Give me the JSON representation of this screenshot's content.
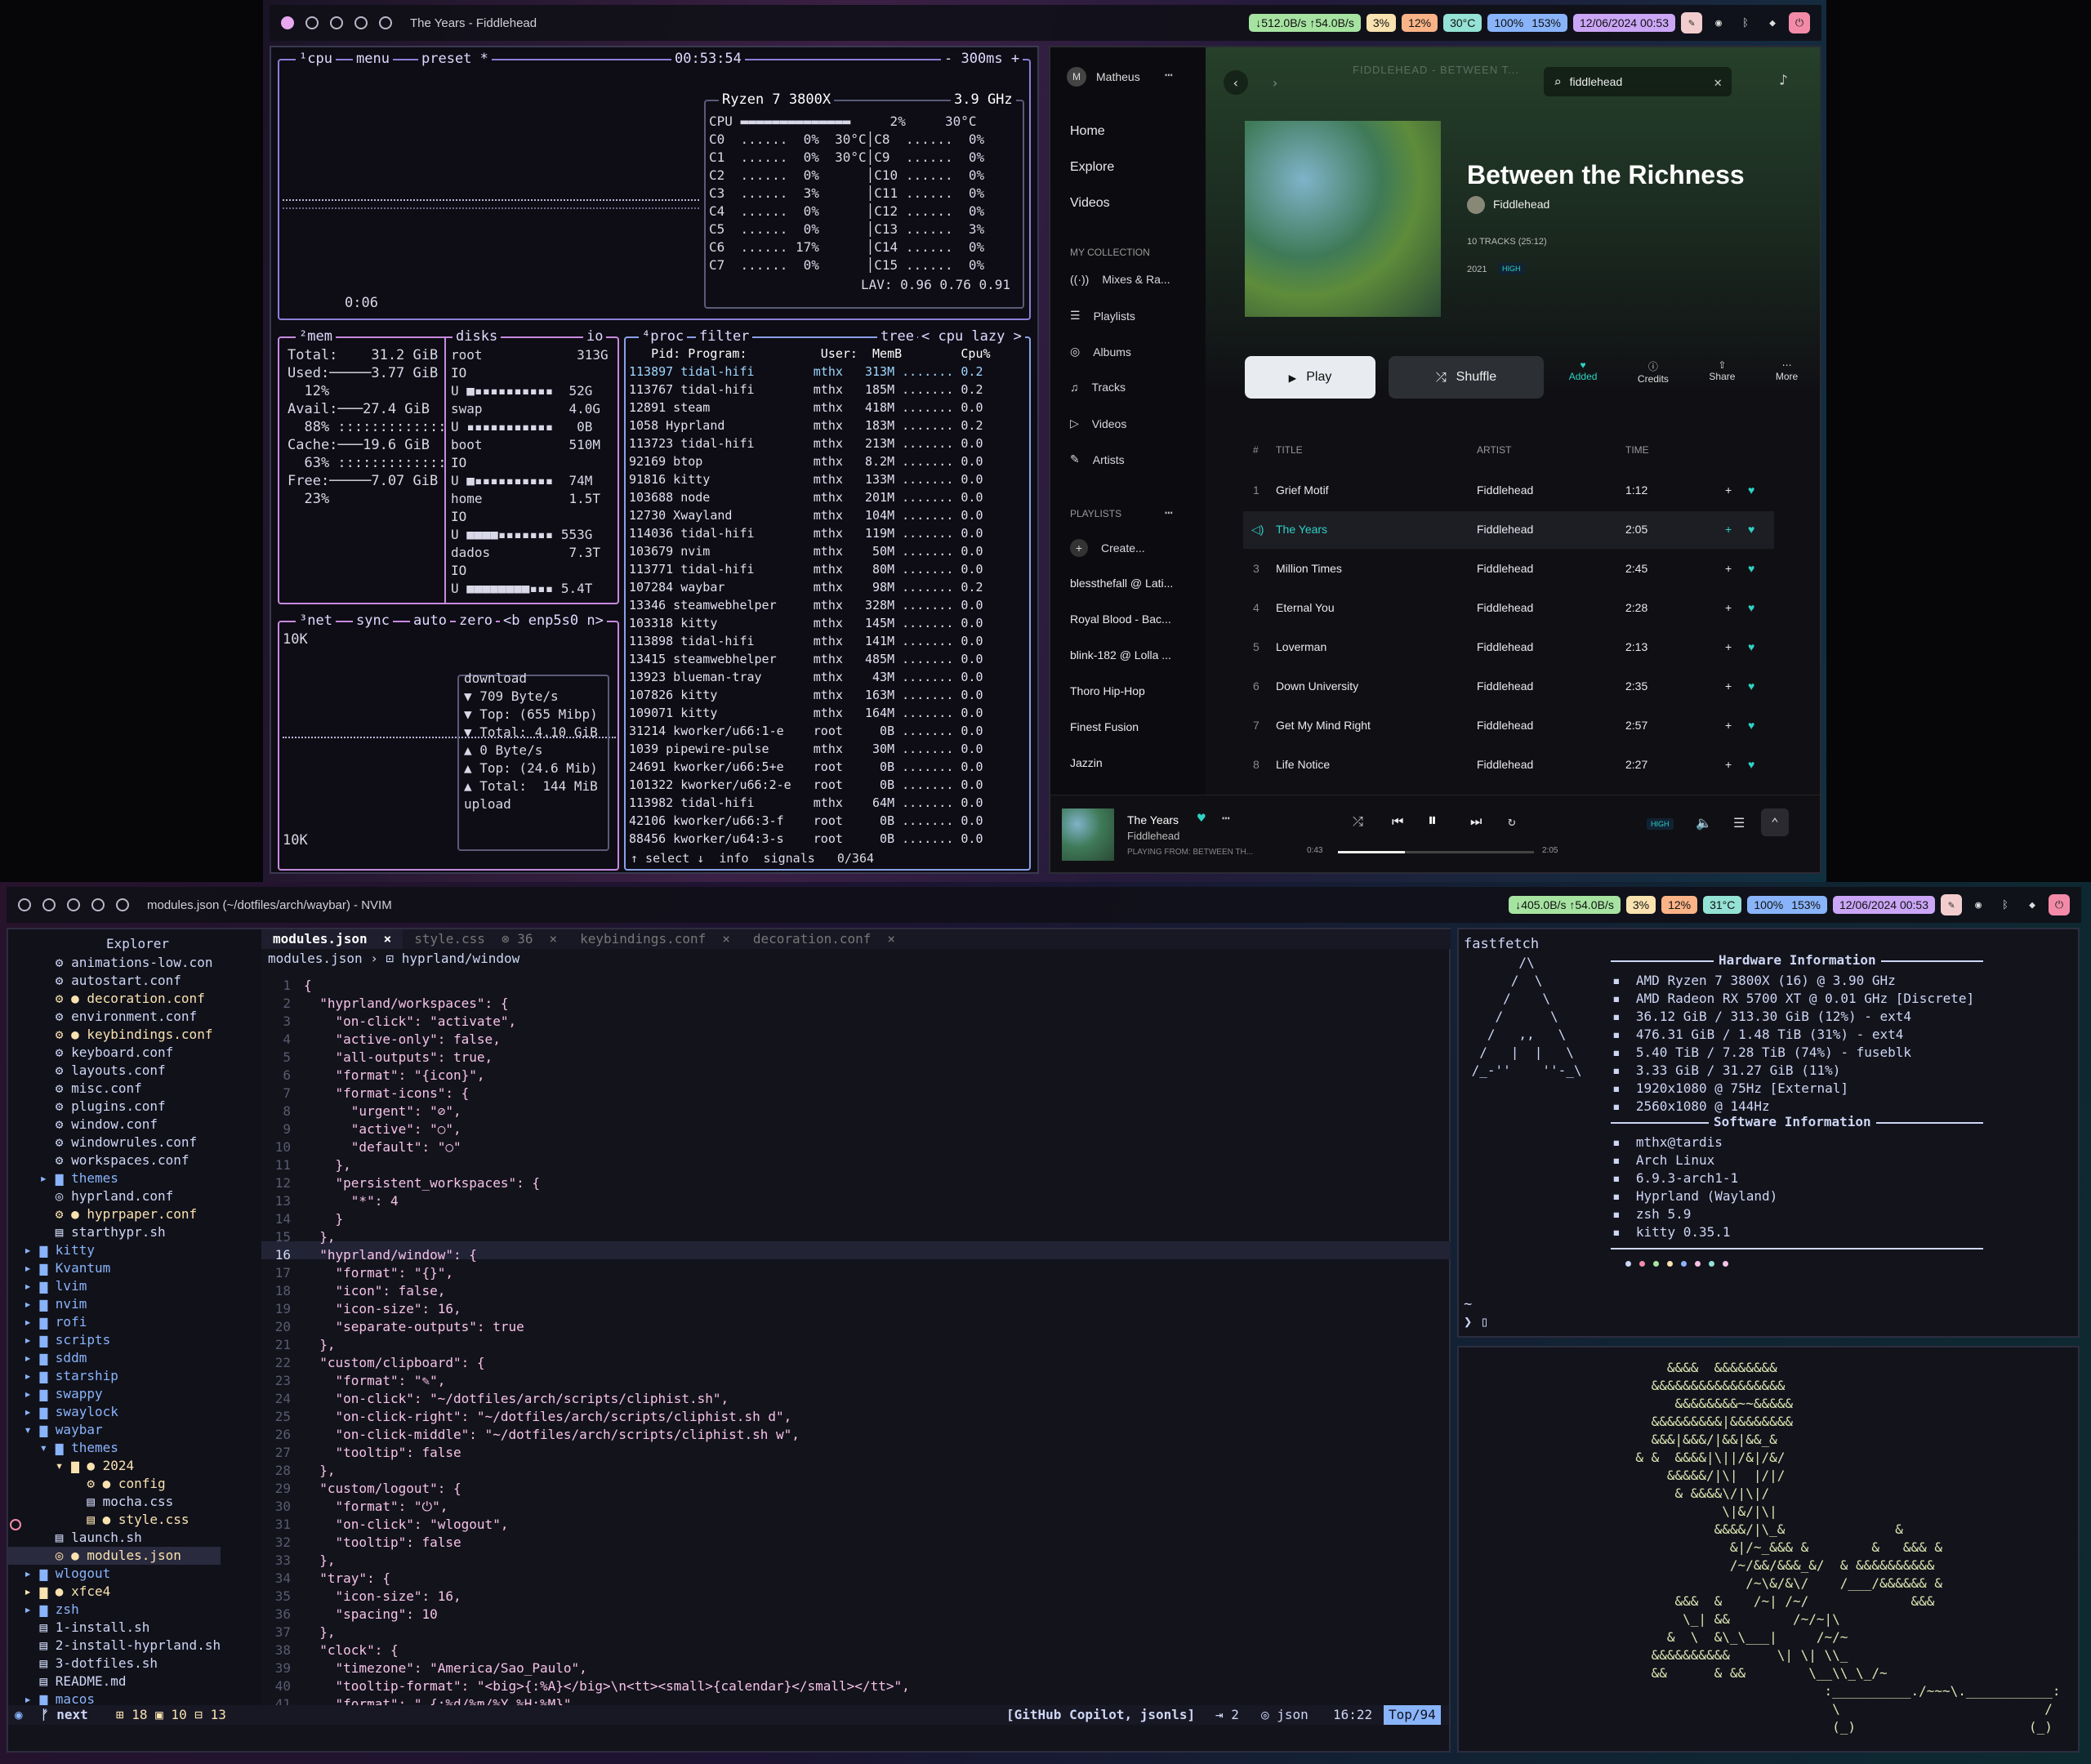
{
  "top_bar": {
    "title": "The Years - Fiddlehead",
    "net": "↓512.0B/s ↑54.0B/s",
    "cpu": "3%",
    "mem": "12%",
    "temp": "30°C",
    "vol": "100%",
    "mic": "153%",
    "clock": "12/06/2024 00:53"
  },
  "bottom_bar": {
    "title": "modules.json (~/dotfiles/arch/waybar) - NVIM",
    "net": "↓405.0B/s ↑54.0B/s",
    "cpu": "3%",
    "mem": "12%",
    "temp": "31°C",
    "vol": "100%",
    "mic": "153%",
    "clock": "12/06/2024 00:53"
  },
  "btop": {
    "cpu_title": "¹cpu",
    "menu": "menu",
    "preset": "preset *",
    "clock": "00:53:54",
    "refresh": "- 300ms +",
    "uptime": "0:06",
    "cpu_name": "Ryzen 7 3800X",
    "ghz": "3.9 GHz",
    "cpu_total": "CPU ▬▬▬▬▬▬▬▬▬▬▬▬▬▬     2%     30°C",
    "cores": [
      "C0  ......  0%  30°C│C8  ......  0%",
      "C1  ......  0%  30°C│C9  ......  0%",
      "C2  ......  0%      │C10 ......  0%",
      "C3  ......  3%      │C11 ......  0%",
      "C4  ......  0%      │C12 ......  0%",
      "C5  ......  0%      │C13 ......  3%",
      "C6  ...... 17%      │C14 ......  0%",
      "C7  ......  0%      │C15 ......  0%"
    ],
    "lav": "LAV: 0.96 0.76 0.91",
    "mem_title": "²mem",
    "disks_title": "disks",
    "io": "io",
    "mem_lines": [
      "Total:    31.2 GiB",
      "Used:─────3.77 GiB",
      "  12%",
      "",
      "Avail:───27.4 GiB",
      "  88% :::::::::::::",
      "",
      "Cache:───19.6 GiB",
      "  63% :::::::::::::",
      "",
      "Free:─────7.07 GiB",
      "  23%"
    ],
    "disk_lines": [
      "root            313G",
      "IO",
      "U ■▪▪▪▪▪▪▪▪▪▪  52G",
      "swap           4.0G",
      "U ▪▪▪▪▪▪▪▪▪▪▪   0B",
      "boot           510M",
      "IO",
      "U ■▪▪▪▪▪▪▪▪▪▪  74M",
      "home           1.5T",
      "IO",
      "U ■■■■▪▪▪▪▪▪▪ 553G",
      "dados          7.3T",
      "IO",
      "U ■■■■■■■■▪▪▪ 5.4T"
    ],
    "net_title": "³net",
    "sync": "sync",
    "auto": "auto",
    "zero": "zero",
    "iface": "<b enp5s0 n>",
    "net_top": "10K",
    "net_bot": "10K",
    "net_lines": [
      "download",
      "▼ 709 Byte/s",
      "▼ Top: (655 Mibp)",
      "▼ Total: 4.10 GiB",
      "",
      "▲ 0 Byte/s",
      "▲ Top: (24.6 Mib)",
      "▲ Total:  144 MiB",
      "upload"
    ],
    "proc_title": "⁴proc",
    "filter": "filter",
    "tree": "tree",
    "sort": "< cpu lazy >",
    "proc_header": "   Pid: Program:          User:  MemB        Cpu%",
    "procs": [
      "113897 tidal-hifi        mthx   313M ....... 0.2",
      "113767 tidal-hifi        mthx   185M ....... 0.2",
      "12891 steam              mthx   418M ....... 0.0",
      "1058 Hyprland            mthx   183M ....... 0.2",
      "113723 tidal-hifi        mthx   213M ....... 0.0",
      "92169 btop               mthx   8.2M ....... 0.0",
      "91816 kitty              mthx   133M ....... 0.0",
      "103688 node              mthx   201M ....... 0.0",
      "12730 Xwayland           mthx   104M ....... 0.0",
      "114036 tidal-hifi        mthx   119M ....... 0.0",
      "103679 nvim              mthx    50M ....... 0.0",
      "113771 tidal-hifi        mthx    80M ....... 0.0",
      "107284 waybar            mthx    98M ....... 0.2",
      "13346 steamwebhelper     mthx   328M ....... 0.0",
      "103318 kitty             mthx   145M ....... 0.0",
      "113898 tidal-hifi        mthx   141M ....... 0.0",
      "13415 steamwebhelper     mthx   485M ....... 0.0",
      "13923 blueman-tray       mthx    43M ....... 0.0",
      "107826 kitty             mthx   163M ....... 0.0",
      "109071 kitty             mthx   164M ....... 0.0",
      "31214 kworker/u66:1-e    root     0B ....... 0.0",
      "1039 pipewire-pulse      mthx    30M ....... 0.0",
      "24691 kworker/u66:5+e    root     0B ....... 0.0",
      "101322 kworker/u66:2-e   root     0B ....... 0.0",
      "113982 tidal-hifi        mthx    64M ....... 0.0",
      "42106 kworker/u66:3-f    root     0B ....... 0.0",
      "88456 kworker/u64:3-s    root     0B ....... 0.0"
    ],
    "proc_footer": "↑ select ↓  info  signals   0/364"
  },
  "tidal": {
    "user_initial": "M",
    "user": "Matheus",
    "nav": [
      "Home",
      "Explore",
      "Videos"
    ],
    "collection_header": "MY COLLECTION",
    "collection": [
      "Mixes & Ra...",
      "Playlists",
      "Albums",
      "Tracks",
      "Videos",
      "Artists"
    ],
    "playlists_header": "PLAYLISTS",
    "playlists": [
      "Create...",
      "blessthefall @ Lati...",
      "Royal Blood - Bac...",
      "blink-182 @ Lolla ...",
      "Thoro Hip-Hop",
      "Finest Fusion",
      "Jazzin"
    ],
    "search": "fiddlehead",
    "banner": "FIDDLEHEAD - BETWEEN T...",
    "album": "Between the Richness",
    "artist": "Fiddlehead",
    "tracks_info": "10 TRACKS (25:12)",
    "year": "2021",
    "quality": "HIGH",
    "play": "Play",
    "shuffle": "Shuffle",
    "actions": [
      "Added",
      "Credits",
      "Share",
      "More"
    ],
    "cols": [
      "#",
      "TITLE",
      "ARTIST",
      "TIME"
    ],
    "tracks": [
      {
        "n": "1",
        "t": "Grief Motif",
        "a": "Fiddlehead",
        "d": "1:12"
      },
      {
        "n": "",
        "t": "The Years",
        "a": "Fiddlehead",
        "d": "2:05"
      },
      {
        "n": "3",
        "t": "Million Times",
        "a": "Fiddlehead",
        "d": "2:45"
      },
      {
        "n": "4",
        "t": "Eternal You",
        "a": "Fiddlehead",
        "d": "2:28"
      },
      {
        "n": "5",
        "t": "Loverman",
        "a": "Fiddlehead",
        "d": "2:13"
      },
      {
        "n": "6",
        "t": "Down University",
        "a": "Fiddlehead",
        "d": "2:35"
      },
      {
        "n": "7",
        "t": "Get My Mind Right",
        "a": "Fiddlehead",
        "d": "2:57"
      },
      {
        "n": "8",
        "t": "Life Notice",
        "a": "Fiddlehead",
        "d": "2:27"
      }
    ],
    "now_title": "The Years",
    "now_artist": "Fiddlehead",
    "now_from": "PLAYING FROM: BETWEEN TH...",
    "elapsed": "0:43",
    "total": "2:05",
    "progress": 0.34,
    "np_quality": "HIGH"
  },
  "nvim": {
    "explorer": "Explorer",
    "tabs": [
      {
        "name": "modules.json",
        "mark": "×"
      },
      {
        "name": "style.css",
        "mark": "⊗ 36"
      },
      {
        "name": "keybindings.conf",
        "mark": "×"
      },
      {
        "name": "decoration.conf",
        "mark": "×"
      }
    ],
    "breadcrumb": "modules.json › ⊡ hyprland/window",
    "tree": [
      "      ⚙ animations-low.con",
      "      ⚙ autostart.conf",
      "      ⚙ ● decoration.conf",
      "      ⚙ environment.conf",
      "      ⚙ ● keybindings.conf",
      "      ⚙ keyboard.conf",
      "      ⚙ layouts.conf",
      "      ⚙ misc.conf",
      "      ⚙ plugins.conf",
      "      ⚙ window.conf",
      "      ⚙ windowrules.conf",
      "      ⚙ workspaces.conf",
      "    ▸ ▆ themes",
      "      ◎ hyprland.conf",
      "      ⚙ ● hyprpaper.conf",
      "      ▤ starthypr.sh",
      "  ▸ ▆ kitty",
      "  ▸ ▆ Kvantum",
      "  ▸ ▆ lvim",
      "  ▸ ▆ nvim",
      "  ▸ ▆ rofi",
      "  ▸ ▆ scripts",
      "  ▸ ▆ sddm",
      "  ▸ ▆ starship",
      "  ▸ ▆ swappy",
      "  ▸ ▆ swaylock",
      "  ▾ ▆ waybar",
      "    ▾ ▆ themes",
      "      ▾ ▆ ● 2024",
      "          ⚙ ● config",
      "          ▤ mocha.css",
      "          ▤ ● style.css",
      "      ▤ launch.sh",
      "      ◎ ● modules.json",
      "  ▸ ▆ wlogout",
      "  ▸ ▆ ● xfce4",
      "  ▸ ▆ zsh",
      "    ▤ 1-install.sh",
      "    ▤ 2-install-hyprland.sh",
      "    ▤ 3-dotfiles.sh",
      "    ▤ README.md",
      "  ▸ ▆ macos"
    ],
    "code": [
      "{",
      "  \"hyprland/workspaces\": {",
      "    \"on-click\": \"activate\",",
      "    \"active-only\": false,",
      "    \"all-outputs\": true,",
      "    \"format\": \"{icon}\",",
      "    \"format-icons\": {",
      "      \"urgent\": \"⊘\",",
      "      \"active\": \"○\",",
      "      \"default\": \"○\"",
      "    },",
      "    \"persistent_workspaces\": {",
      "      \"*\": 4",
      "    }",
      "  },",
      "  \"hyprland/window\": {",
      "    \"format\": \"{}\",",
      "    \"icon\": false,",
      "    \"icon-size\": 16,",
      "    \"separate-outputs\": true",
      "  },",
      "  \"custom/clipboard\": {",
      "    \"format\": \"✎\",",
      "    \"on-click\": \"~/dotfiles/arch/scripts/cliphist.sh\",",
      "    \"on-click-right\": \"~/dotfiles/arch/scripts/cliphist.sh d\",",
      "    \"on-click-middle\": \"~/dotfiles/arch/scripts/cliphist.sh w\",",
      "    \"tooltip\": false",
      "  },",
      "  \"custom/logout\": {",
      "    \"format\": \"⏻\",",
      "    \"on-click\": \"wlogout\",",
      "    \"tooltip\": false",
      "  },",
      "  \"tray\": {",
      "    \"icon-size\": 16,",
      "    \"spacing\": 10",
      "  },",
      "  \"clock\": {",
      "    \"timezone\": \"America/Sao_Paulo\",",
      "    \"tooltip-format\": \"<big>{:%A}</big>\\n<tt><small>{calendar}</small></tt>\",",
      "    \"format\": \" {:%d/%m/%Y %H:%M}\""
    ],
    "status_mode": "◉",
    "status_branch": "ᚠ next",
    "status_diff": "⊞ 18  ▣ 10  ⊟ 13",
    "status_lsp": "[GitHub Copilot, jsonls]",
    "status_indent": "⇥ 2",
    "status_ft": "◎ json",
    "status_pos": "16:22",
    "status_pct": "Top/94"
  },
  "fastfetch": {
    "cmd": "fastfetch",
    "hw_title": "Hardware Information",
    "sw_title": "Software Information",
    "hw": [
      "AMD Ryzen 7 3800X (16) @ 3.90 GHz",
      "AMD Radeon RX 5700 XT @ 0.01 GHz [Discrete]",
      "36.12 GiB / 313.30 GiB (12%) - ext4",
      "476.31 GiB / 1.48 TiB (31%) - ext4",
      "5.40 TiB / 7.28 TiB (74%) - fuseblk",
      "3.33 GiB / 31.27 GiB (11%)",
      "1920x1080 @ 75Hz [External]",
      "2560x1080 @ 144Hz"
    ],
    "sw": [
      "mthx@tardis",
      "Arch Linux",
      "6.9.3-arch1-1",
      "Hyprland (Wayland)",
      "zsh 5.9",
      "kitty 0.35.1"
    ],
    "logo": "       /\\\n      /  \\\n     /    \\\n    /      \\\n   /   ,,   \\\n  /   |  |   \\\n /_-''    ''-_\\",
    "prompt": "~\n❯ ▯"
  },
  "ascii_art": "              &&&&  &&&&&&&&\n            &&&&&&&&&&&&&&&&&\n               &&&&&&&&~~&&&&&\n            &&&&&&&&&|&&&&&&&&\n            &&&|&&&/|&&|&&_&\n          & &  &&&&|\\||/&|/&/\n              &&&&&/|\\|  |/|/\n               & &&&&\\/|\\|/\n                     \\|&/|\\|\n                    &&&&/|\\_&              &\n                      &|/~_&&& &        &   &&& &\n                      /~/&&/&&&_&/  & &&&&&&&&&&\n                        /~\\&/&\\/    /___/&&&&&& &\n               &&&  &    /~| /~/             &&&\n                \\_| &&        /~/~|\\\n              &  \\  &\\_\\___|     /~/~\n            &&&&&&&&&&      \\| \\| \\\\_\n            &&      & &&        \\__\\\\_\\_/~\n                                  :__________./~~~\\.___________:\n                                   \\                          /\n                                   (_)                      (_)"
}
